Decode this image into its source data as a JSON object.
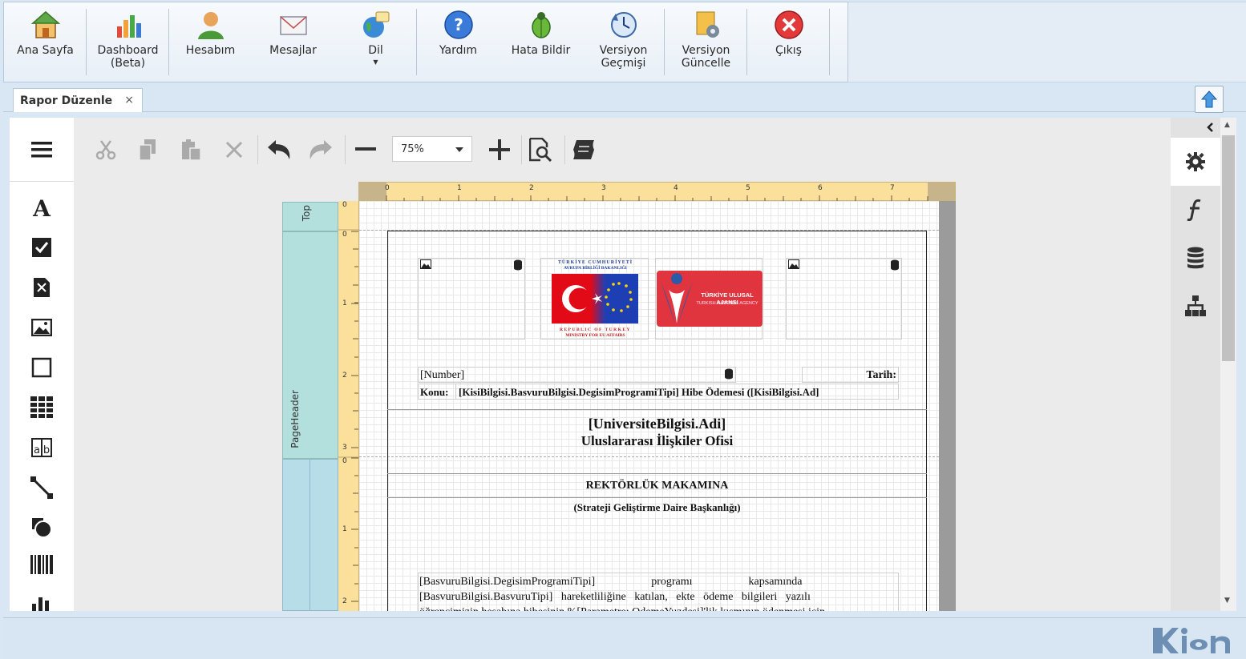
{
  "toolbar": {
    "items": [
      {
        "label": "Ana Sayfa",
        "icon": "home-icon"
      },
      {
        "label": "Dashboard\n(Beta)",
        "icon": "bar-chart-icon"
      },
      {
        "label": "Hesabım",
        "icon": "user-icon"
      },
      {
        "label": "Mesajlar",
        "icon": "envelope-icon"
      },
      {
        "label": "Dil",
        "icon": "globe-icon"
      },
      {
        "label": "Yardım",
        "icon": "help-icon"
      },
      {
        "label": "Hata Bildir",
        "icon": "bug-icon"
      },
      {
        "label": "Versiyon\nGeçmişi",
        "icon": "history-icon"
      },
      {
        "label": "Versiyon\nGüncelle",
        "icon": "update-icon"
      },
      {
        "label": "Çıkış",
        "icon": "exit-icon"
      }
    ]
  },
  "tabs": [
    {
      "label": "Rapor Düzenle",
      "close": "×"
    }
  ],
  "editor": {
    "zoom": "75%",
    "ruler_top": [
      "0",
      "1",
      "2",
      "3",
      "4",
      "5",
      "6",
      "7"
    ],
    "ruler_left_top": [
      "0"
    ],
    "ruler_left_header": [
      "0",
      "1",
      "2",
      "3"
    ],
    "ruler_left_detail": [
      "0",
      "1",
      "2"
    ],
    "bands": {
      "top": "Top",
      "page_header": "PageHeader"
    }
  },
  "report": {
    "logo_left_top": "TÜRKİYE CUMHURİYETİ",
    "logo_left_top2": "AVRUPA BİRLİĞİ BAKANLIĞI",
    "logo_left_bottom": "REPUBLIC OF TURKEY",
    "logo_left_bottom2": "MINISTRY FOR EU AFFAIRS",
    "logo_right_title": "TÜRKİYE ULUSAL AJANSI",
    "logo_right_sub": "TURKISH NATIONAL AGENCY",
    "number_field": "[Number]",
    "date_label": "Tarih:",
    "subject_label": "Konu:",
    "subject_value": "[KisiBilgisi.BasvuruBilgisi.DegisimProgramiTipi] Hibe Ödemesi ([KisiBilgisi.Ad]",
    "university": "[UniversiteBilgisi.Adi]",
    "office": "Uluslararası İlişkiler Ofisi",
    "rector": "REKTÖRLÜK MAKAMINA",
    "department": "(Strateji Geliştirme Daire Başkanlığı)",
    "body_line1": "[BasvuruBilgisi.DegisimProgramiTipi]                    programı                    kapsamında",
    "body_line2": "[BasvuruBilgisi.BasvuruTipi]   hareketliliğine   katılan,   ekte   ödeme   bilgileri   yazılı",
    "body_line3": "öğrencimizin hesabına hibesinin %[Parametre: OdemeYuzdesi]'lik kısmının ödenmesi için"
  },
  "colors": {
    "accent": "#2a6ebb",
    "band": "#b3e0dc",
    "band_detail": "#b7dde9",
    "ruler": "#fae09a"
  }
}
